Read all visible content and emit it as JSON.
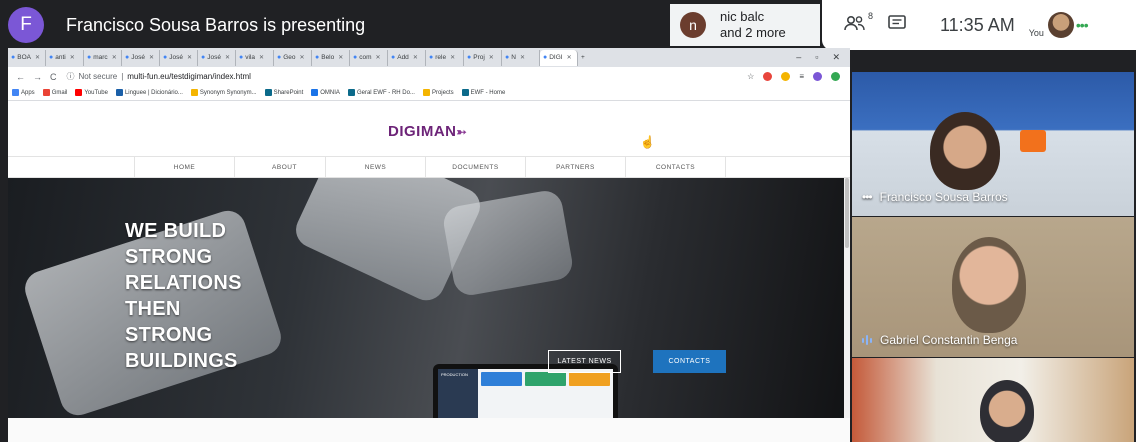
{
  "meet": {
    "presenter_initial": "F",
    "presenter_text": "Francisco Sousa Barros is presenting",
    "others_initial": "n",
    "others_line1": "nic balc",
    "others_line2": "and 2 more",
    "participants_count": "8",
    "time": "11:35 AM",
    "you_label": "You"
  },
  "browser": {
    "tabs": [
      {
        "label": "BOA"
      },
      {
        "label": "anti"
      },
      {
        "label": "marc"
      },
      {
        "label": "José"
      },
      {
        "label": "José"
      },
      {
        "label": "José"
      },
      {
        "label": "vila"
      },
      {
        "label": "Geo"
      },
      {
        "label": "Belo"
      },
      {
        "label": "com"
      },
      {
        "label": "Add"
      },
      {
        "label": "rele"
      },
      {
        "label": "Proj"
      },
      {
        "label": "N"
      },
      {
        "label": "DIGI"
      }
    ],
    "new_tab": "+",
    "url_secure": "Not secure",
    "url": "multi-fun.eu/testdigiman/index.html",
    "bookmarks": [
      {
        "label": "Apps",
        "color": "#4285f4"
      },
      {
        "label": "Gmail",
        "color": "#ea4335"
      },
      {
        "label": "YouTube",
        "color": "#ff0000"
      },
      {
        "label": "Linguee | Dicionário...",
        "color": "#1a5fa8"
      },
      {
        "label": "Synonym Synonym...",
        "color": "#f4b400"
      },
      {
        "label": "SharePoint",
        "color": "#0b6a8a"
      },
      {
        "label": "OMNIA",
        "color": "#1a73e8"
      },
      {
        "label": "Geral EWF - RH Do...",
        "color": "#0b6a8a"
      },
      {
        "label": "Projects",
        "color": "#f4b400"
      },
      {
        "label": "EWF - Home",
        "color": "#0b6a8a"
      }
    ]
  },
  "site": {
    "logo": "DIGIMAN",
    "nav": [
      "HOME",
      "ABOUT",
      "NEWS",
      "DOCUMENTS",
      "PARTNERS",
      "CONTACTS"
    ],
    "tagline": [
      "WE BUILD",
      "STRONG",
      "RELATIONS",
      "THEN",
      "STRONG",
      "BUILDINGS"
    ],
    "btn_latest": "LATEST NEWS",
    "btn_contacts": "CONTACTS",
    "tablet_label": "PRODUCTION"
  },
  "participants": [
    {
      "name": "Francisco Sousa Barros"
    },
    {
      "name": "Gabriel Constantin Benga"
    }
  ],
  "colors": {
    "presenter_avatar": "#7b57d6",
    "logo": "#6d2478",
    "contacts_button": "#1e73be"
  }
}
